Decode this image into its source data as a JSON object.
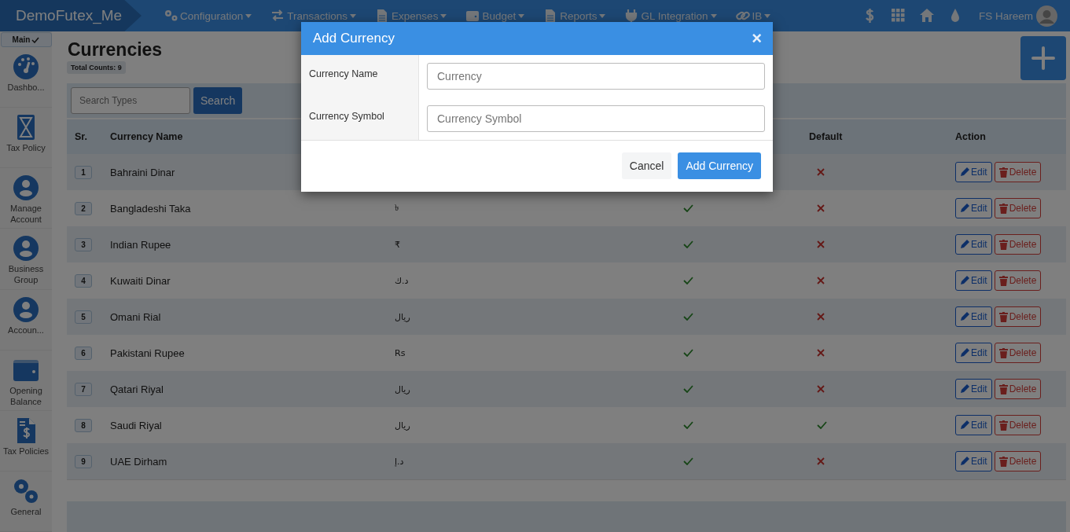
{
  "navbar": {
    "brand": "DemoFutex_Me",
    "menus": [
      {
        "label": "Configuration"
      },
      {
        "label": "Transactions"
      },
      {
        "label": "Expenses"
      },
      {
        "label": "Budget"
      },
      {
        "label": "Reports"
      },
      {
        "label": "GL Integration"
      },
      {
        "label": "IB"
      }
    ],
    "user": "FS Hareem"
  },
  "sidebar": {
    "tab": {
      "label": "Main",
      "checked": true
    },
    "items": [
      {
        "label": "Dashbo..."
      },
      {
        "label": "Tax Policy"
      },
      {
        "label": "Manage Account"
      },
      {
        "label": "Business Group"
      },
      {
        "label": "Accoun..."
      },
      {
        "label": "Opening Balance"
      },
      {
        "label": "Tax Policies"
      },
      {
        "label": "General"
      }
    ]
  },
  "page": {
    "title": "Currencies",
    "count_badge": "Total Counts: 9",
    "search": {
      "placeholder": "Search Types",
      "button": "Search"
    }
  },
  "table": {
    "columns": [
      {
        "kind": "text",
        "label": "Sr."
      },
      {
        "kind": "text",
        "label": "Currency Name"
      },
      {
        "kind": "hidden"
      },
      {
        "kind": "hidden"
      },
      {
        "kind": "text",
        "label": "Default"
      },
      {
        "kind": "text",
        "label": "Action"
      }
    ],
    "rows": [
      {
        "sr": "1",
        "name": "Bahraini Dinar",
        "default": false,
        "actions": [
          "Edit",
          "Delete"
        ]
      },
      {
        "sr": "2",
        "name": "Bangladeshi Taka",
        "symbol": "৳",
        "column_4": true,
        "default": false,
        "actions": [
          "Edit",
          "Delete"
        ]
      },
      {
        "sr": "3",
        "name": "Indian Rupee",
        "symbol": "₹",
        "column_4": true,
        "default": false,
        "actions": [
          "Edit",
          "Delete"
        ]
      },
      {
        "sr": "4",
        "name": "Kuwaiti Dinar",
        "symbol": "د.ك",
        "column_4": true,
        "default": false,
        "actions": [
          "Edit",
          "Delete"
        ]
      },
      {
        "sr": "5",
        "name": "Omani Rial",
        "symbol": "ريال",
        "column_4": true,
        "default": false,
        "actions": [
          "Edit",
          "Delete"
        ]
      },
      {
        "sr": "6",
        "name": "Pakistani Rupee",
        "symbol": "Rs",
        "column_4": true,
        "default": false,
        "actions": [
          "Edit",
          "Delete"
        ]
      },
      {
        "sr": "7",
        "name": "Qatari Riyal",
        "symbol": "ريال",
        "column_4": true,
        "default": false,
        "actions": [
          "Edit",
          "Delete"
        ]
      },
      {
        "sr": "8",
        "name": "Saudi Riyal",
        "symbol": "ريال",
        "column_4": true,
        "default": true,
        "actions": [
          "Edit",
          "Delete"
        ]
      },
      {
        "sr": "9",
        "name": "UAE Dirham",
        "symbol": "د.إ",
        "column_4": true,
        "default": false,
        "actions": [
          "Edit",
          "Delete"
        ]
      }
    ]
  },
  "modal": {
    "title": "Add Currency",
    "close": "×",
    "fields": [
      {
        "label": "Currency Name",
        "placeholder": "Currency"
      },
      {
        "label": "Currency Symbol",
        "placeholder": "Currency Symbol"
      }
    ],
    "buttons": [
      {
        "kind": "secondary",
        "label": "Cancel"
      },
      {
        "kind": "primary",
        "label": "Add Currency"
      }
    ]
  }
}
